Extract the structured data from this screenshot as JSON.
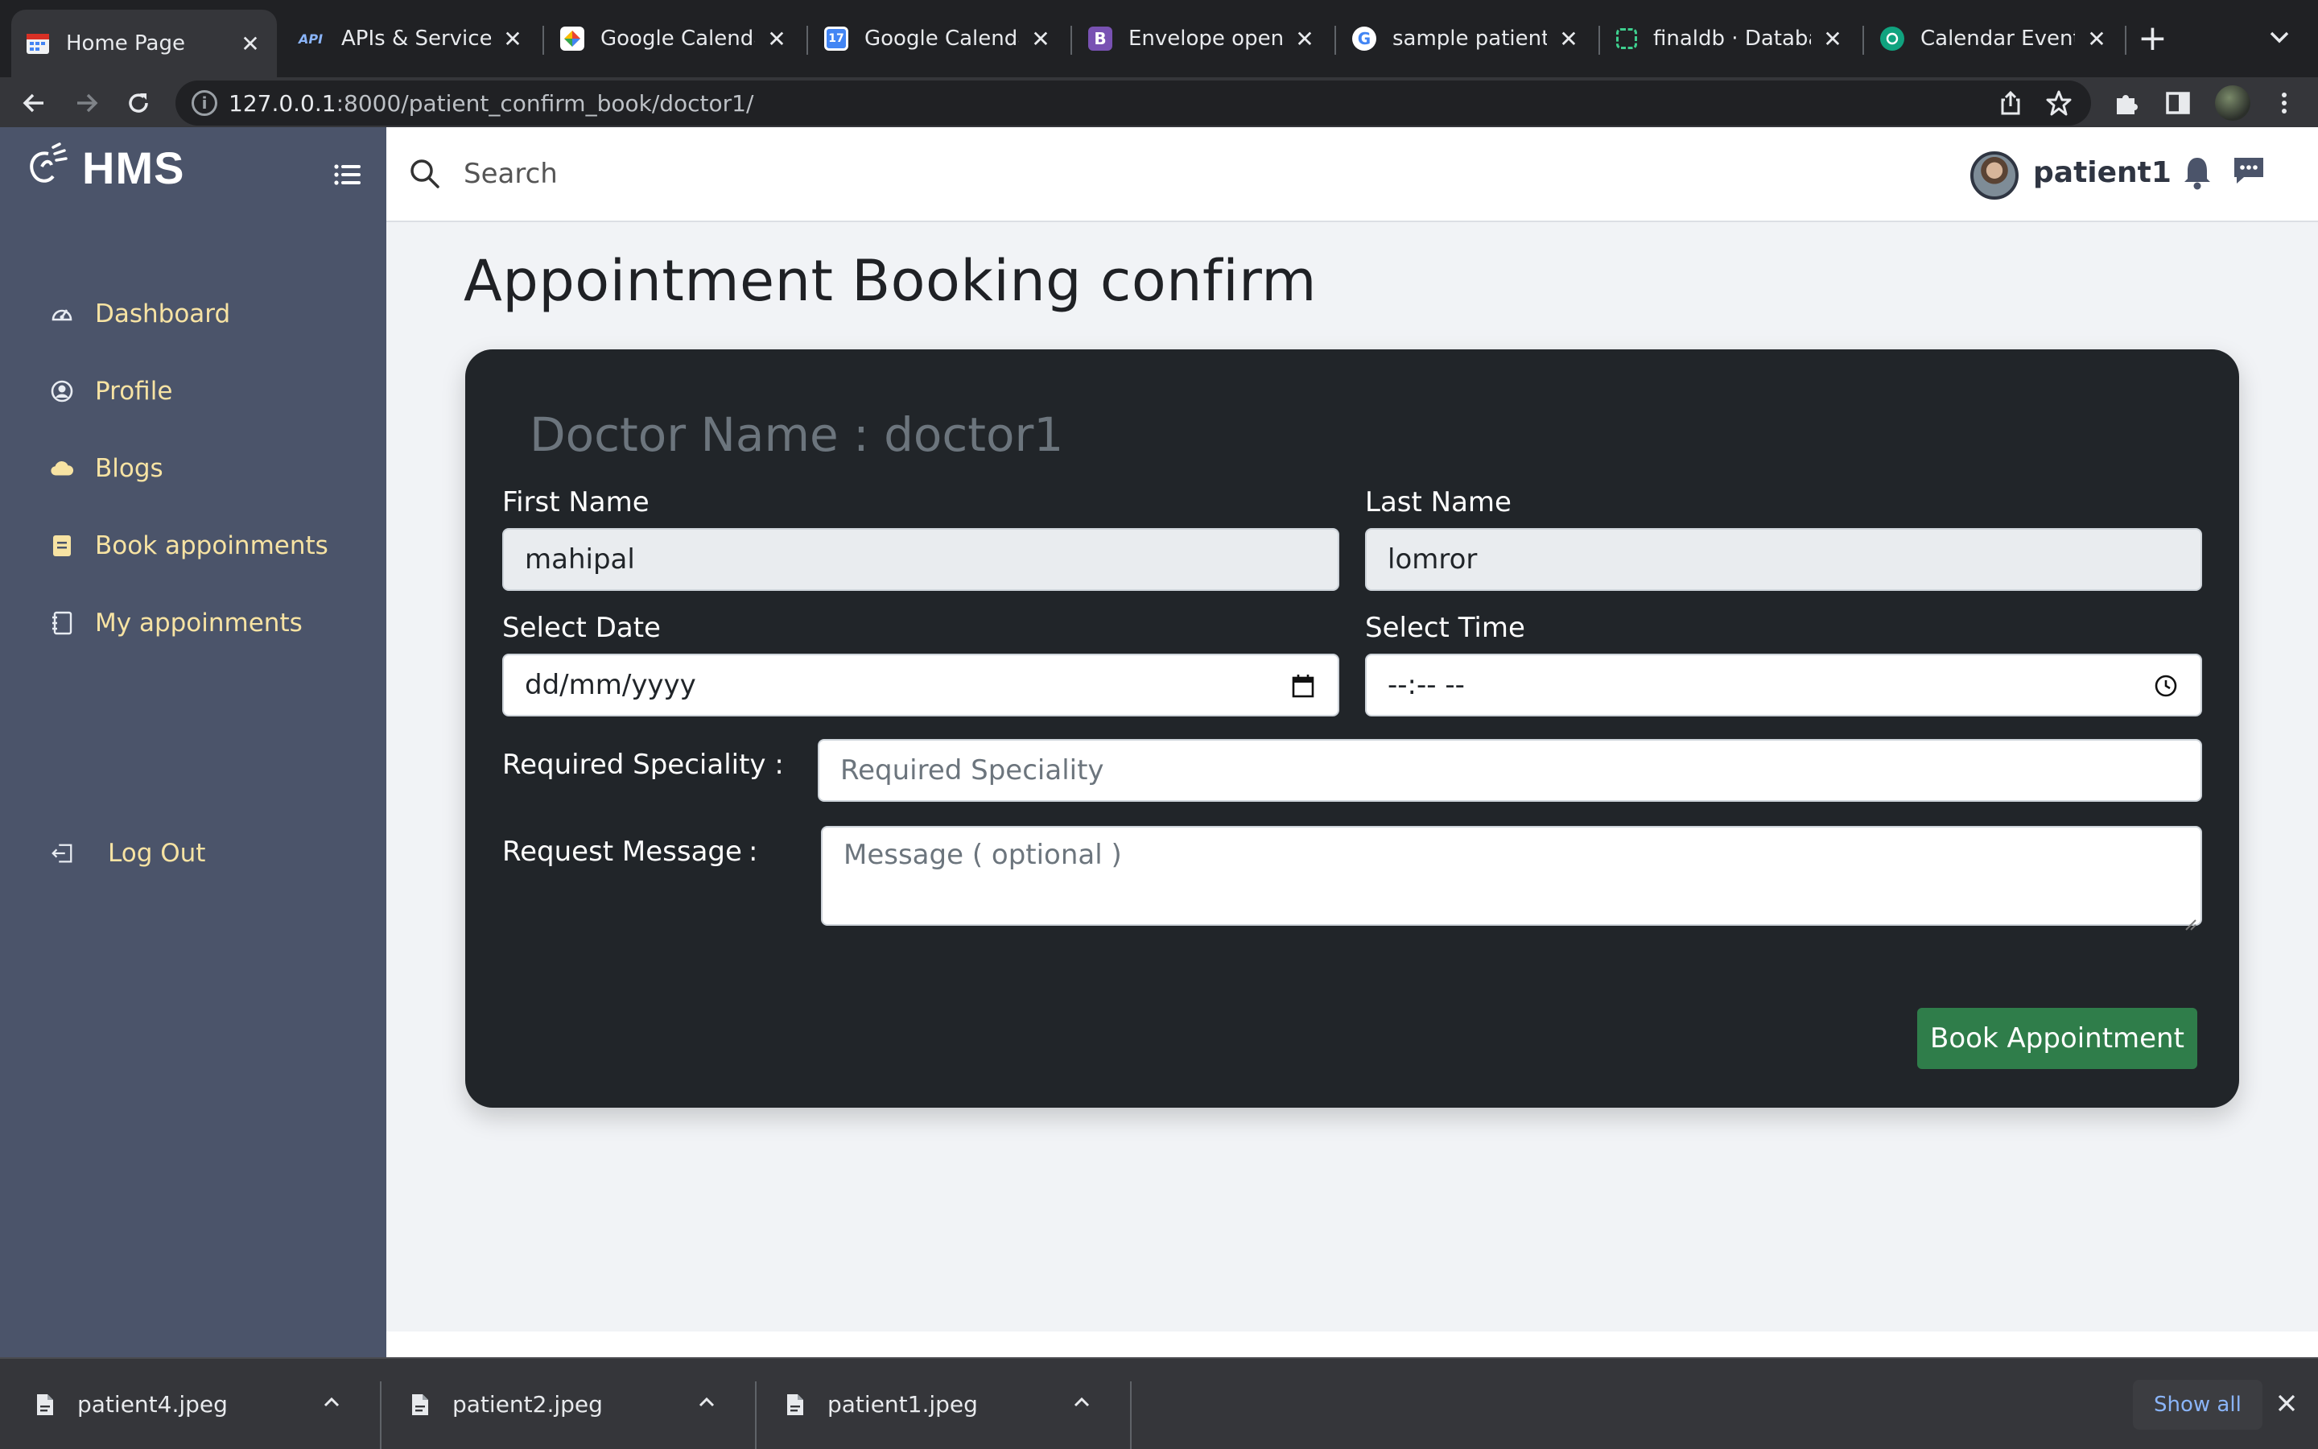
{
  "browser": {
    "tabs": [
      {
        "title": "Home Page",
        "favicon": "calendar-grid-icon",
        "active": true
      },
      {
        "title": "APIs & Services –",
        "favicon": "api-icon"
      },
      {
        "title": "Google Calendar",
        "favicon": "google-calendar-api-icon"
      },
      {
        "title": "Google Calendar",
        "favicon": "google-calendar-17-icon"
      },
      {
        "title": "Envelope open · B",
        "favicon": "bootstrap-icon"
      },
      {
        "title": "sample patient im",
        "favicon": "google-icon"
      },
      {
        "title": "finaldb · Databa",
        "favicon": "database-icon"
      },
      {
        "title": "Calendar Event R",
        "favicon": "openai-icon"
      }
    ],
    "address": {
      "host": "127.0.0.1",
      "path": ":8000/patient_confirm_book/doctor1/"
    }
  },
  "app": {
    "brand": "HMS",
    "search_placeholder": "Search",
    "user": "patient1",
    "sidebar": [
      {
        "label": "Dashboard",
        "icon": "speedometer-icon"
      },
      {
        "label": "Profile",
        "icon": "user-circle-icon"
      },
      {
        "label": "Blogs",
        "icon": "cloud-icon"
      },
      {
        "label": "Book appoinments",
        "icon": "clipboard-icon"
      },
      {
        "label": "My appoinments",
        "icon": "notebook-icon"
      }
    ],
    "logout": "Log Out"
  },
  "page": {
    "title": "Appointment Booking confirm",
    "doctor_line": "Doctor Name : doctor1",
    "form": {
      "first_name_label": "First Name",
      "first_name_value": "mahipal",
      "last_name_label": "Last Name",
      "last_name_value": "lomror",
      "date_label": "Select Date",
      "date_value": "dd/mm/yyyy",
      "time_label": "Select Time",
      "time_value": "--:-- --",
      "speciality_label": "Required Speciality :",
      "speciality_placeholder": "Required Speciality",
      "message_label": "Request Message",
      "message_colon": ":",
      "message_placeholder": "Message ( optional )",
      "submit": "Book Appointment"
    }
  },
  "downloads": {
    "items": [
      "patient4.jpeg",
      "patient2.jpeg",
      "patient1.jpeg"
    ],
    "show_all": "Show all"
  },
  "colors": {
    "sidebar_bg": "#4b546a",
    "sidebar_text": "#f7e3a3",
    "card_bg": "#212529",
    "submit_bg": "#2f7d4a"
  }
}
